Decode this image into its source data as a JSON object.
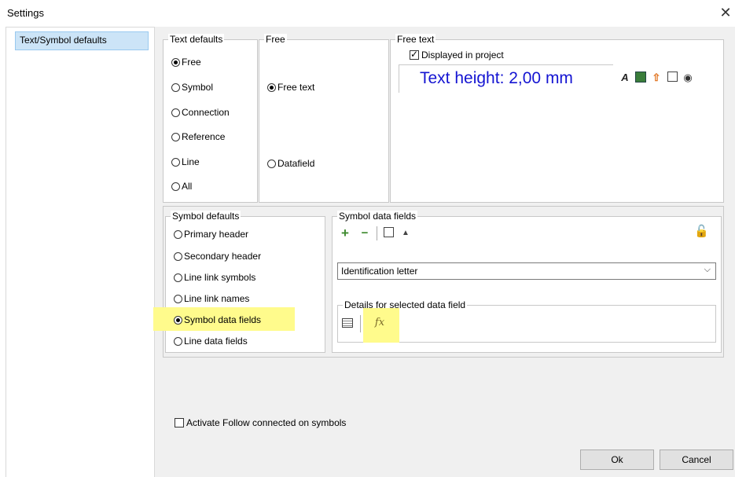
{
  "window": {
    "title": "Settings",
    "close_glyph": "✕"
  },
  "sidebar": {
    "items": [
      {
        "label": "Text/Symbol defaults",
        "selected": true
      }
    ]
  },
  "text_defaults": {
    "legend": "Text defaults",
    "options": [
      "Free",
      "Symbol",
      "Connection",
      "Reference",
      "Line",
      "All"
    ],
    "selected": "Free"
  },
  "free": {
    "legend": "Free",
    "options": [
      "Free text",
      "Datafield"
    ],
    "selected": "Free text"
  },
  "free_text": {
    "legend": "Free text",
    "displayed_label": "Displayed in project",
    "displayed_checked": true,
    "preview_text": "Text height: 2,00 mm",
    "preview_color": "#1414d2",
    "toolbar_icons": [
      "font-style-icon",
      "text-color-icon",
      "move-up-icon",
      "properties-icon",
      "visibility-icon"
    ]
  },
  "symbol_defaults": {
    "legend": "Symbol defaults",
    "options": [
      "Primary header",
      "Secondary header",
      "Line link symbols",
      "Line link names",
      "Symbol data fields",
      "Line data fields"
    ],
    "selected": "Symbol data fields",
    "highlight_color": "#fffb8c"
  },
  "symbol_data_fields": {
    "legend": "Symbol data fields",
    "toolbar_icons": [
      "add-icon",
      "remove-icon",
      "edit-icon",
      "move-up-icon"
    ],
    "lock_icon": "lock-icon",
    "dropdown_value": "Identification letter",
    "details_legend": "Details for selected data field",
    "details_icons": [
      "table-icon",
      "function-fx-icon"
    ],
    "fx_label": "fx"
  },
  "follow_connected": {
    "label": "Activate Follow connected on symbols",
    "checked": false
  },
  "buttons": {
    "ok": "Ok",
    "cancel": "Cancel"
  }
}
